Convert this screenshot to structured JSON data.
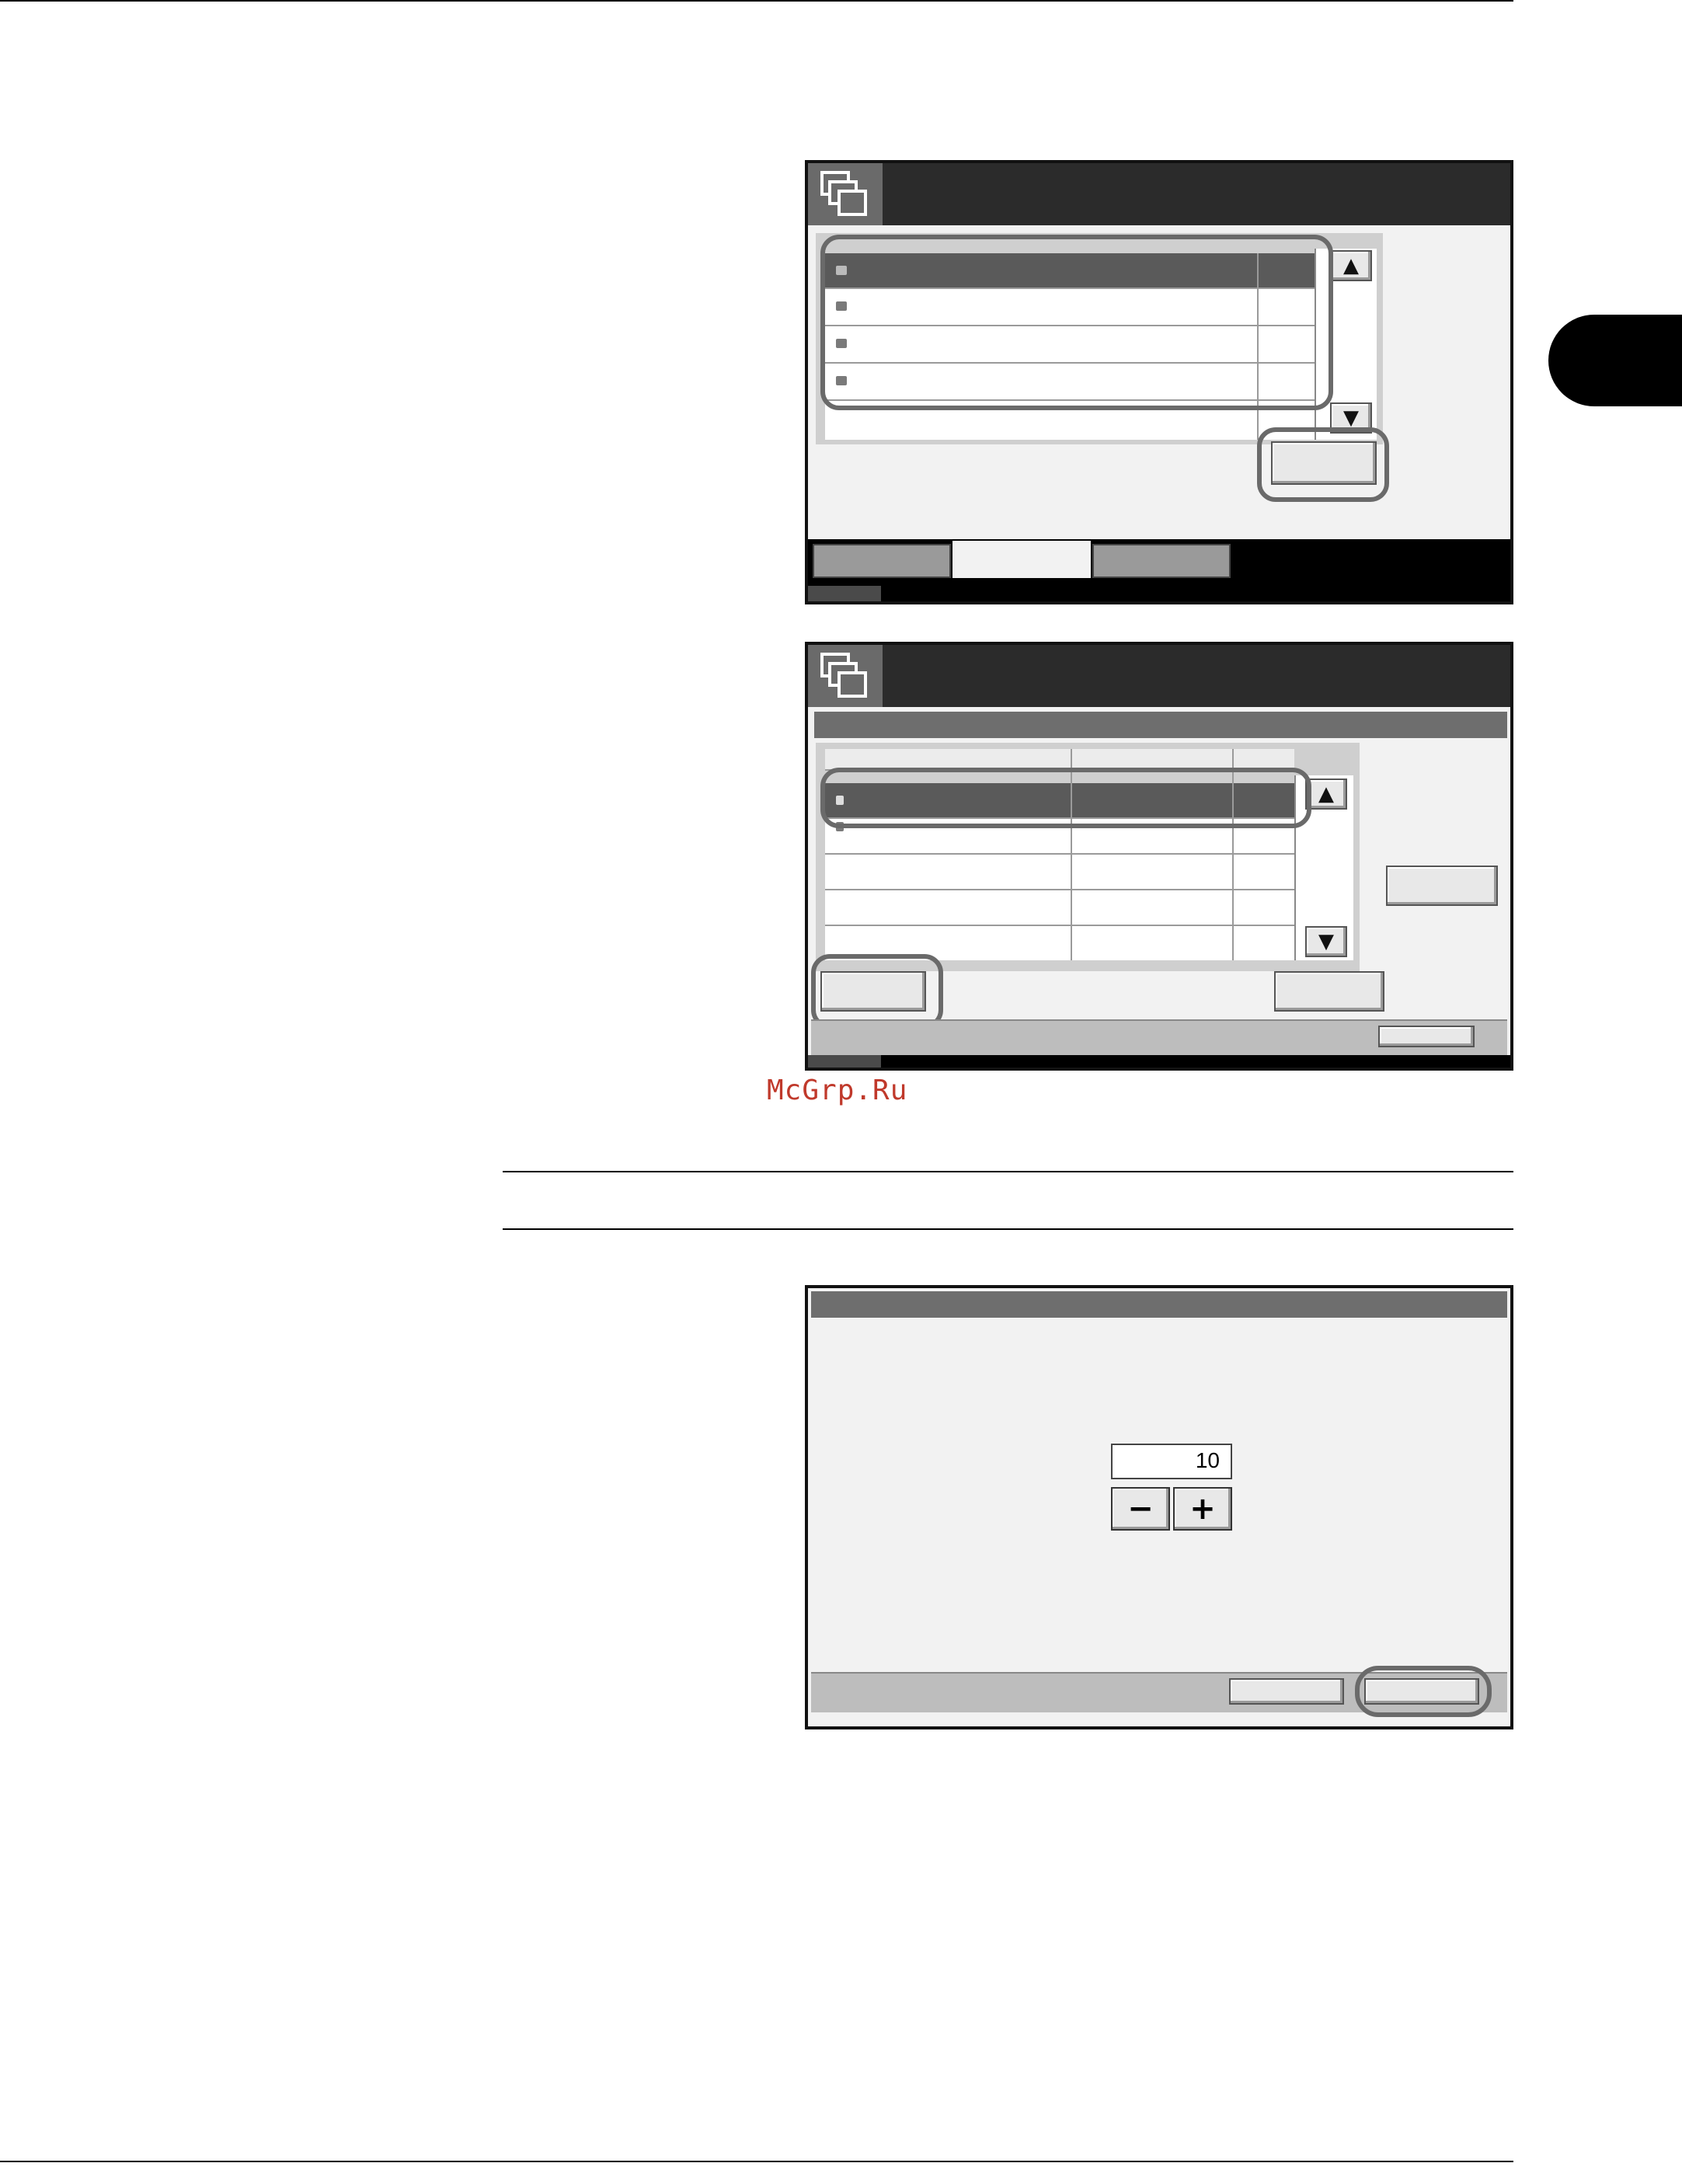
{
  "watermark": {
    "text": "McGrp.Ru"
  },
  "screen1": {
    "title": "",
    "list_rows": [
      "",
      "",
      "",
      ""
    ],
    "selected_row": 0,
    "scroll_up_icon": "triangle-up-icon",
    "scroll_down_icon": "triangle-down-icon",
    "open_button_label": "",
    "tabs": [
      "",
      ""
    ]
  },
  "screen2": {
    "title": "",
    "columns": [
      "",
      "",
      ""
    ],
    "rows": 5,
    "selected_row": 0,
    "scroll_up_icon": "triangle-up-icon",
    "scroll_down_icon": "triangle-down-icon",
    "side_button_label": "",
    "left_button_label": "",
    "right_button_label": "",
    "footer_button_label": ""
  },
  "screen3": {
    "header": "",
    "value": "10",
    "minus_label": "−",
    "plus_label": "+",
    "cancel_label": "",
    "ok_label": ""
  },
  "colors": {
    "highlight_ring": "#6a6a6a",
    "title_bar": "#2b2b2b",
    "screen_bg": "#f2f2f2",
    "watermark": "#c0392b"
  }
}
